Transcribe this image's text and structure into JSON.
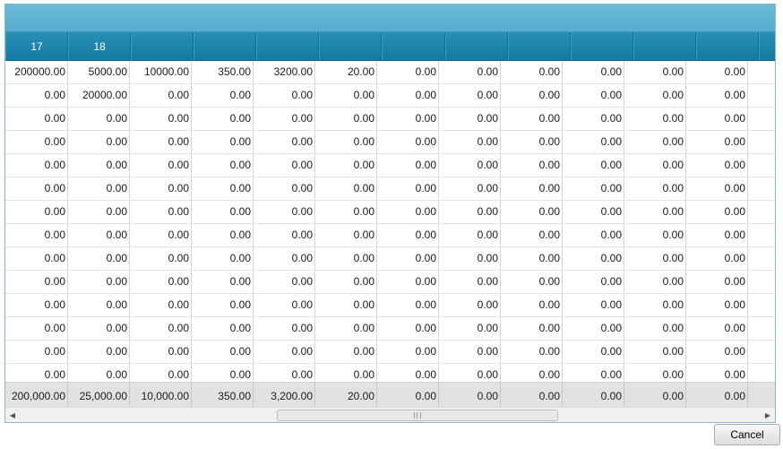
{
  "columns": [
    "17",
    "18",
    "",
    "",
    "",
    "",
    "",
    "",
    "",
    "",
    "",
    ""
  ],
  "rows": [
    [
      "200000.00",
      "5000.00",
      "10000.00",
      "350.00",
      "3200.00",
      "20.00",
      "0.00",
      "0.00",
      "0.00",
      "0.00",
      "0.00",
      "0.00"
    ],
    [
      "0.00",
      "20000.00",
      "0.00",
      "0.00",
      "0.00",
      "0.00",
      "0.00",
      "0.00",
      "0.00",
      "0.00",
      "0.00",
      "0.00"
    ],
    [
      "0.00",
      "0.00",
      "0.00",
      "0.00",
      "0.00",
      "0.00",
      "0.00",
      "0.00",
      "0.00",
      "0.00",
      "0.00",
      "0.00"
    ],
    [
      "0.00",
      "0.00",
      "0.00",
      "0.00",
      "0.00",
      "0.00",
      "0.00",
      "0.00",
      "0.00",
      "0.00",
      "0.00",
      "0.00"
    ],
    [
      "0.00",
      "0.00",
      "0.00",
      "0.00",
      "0.00",
      "0.00",
      "0.00",
      "0.00",
      "0.00",
      "0.00",
      "0.00",
      "0.00"
    ],
    [
      "0.00",
      "0.00",
      "0.00",
      "0.00",
      "0.00",
      "0.00",
      "0.00",
      "0.00",
      "0.00",
      "0.00",
      "0.00",
      "0.00"
    ],
    [
      "0.00",
      "0.00",
      "0.00",
      "0.00",
      "0.00",
      "0.00",
      "0.00",
      "0.00",
      "0.00",
      "0.00",
      "0.00",
      "0.00"
    ],
    [
      "0.00",
      "0.00",
      "0.00",
      "0.00",
      "0.00",
      "0.00",
      "0.00",
      "0.00",
      "0.00",
      "0.00",
      "0.00",
      "0.00"
    ],
    [
      "0.00",
      "0.00",
      "0.00",
      "0.00",
      "0.00",
      "0.00",
      "0.00",
      "0.00",
      "0.00",
      "0.00",
      "0.00",
      "0.00"
    ],
    [
      "0.00",
      "0.00",
      "0.00",
      "0.00",
      "0.00",
      "0.00",
      "0.00",
      "0.00",
      "0.00",
      "0.00",
      "0.00",
      "0.00"
    ],
    [
      "0.00",
      "0.00",
      "0.00",
      "0.00",
      "0.00",
      "0.00",
      "0.00",
      "0.00",
      "0.00",
      "0.00",
      "0.00",
      "0.00"
    ],
    [
      "0.00",
      "0.00",
      "0.00",
      "0.00",
      "0.00",
      "0.00",
      "0.00",
      "0.00",
      "0.00",
      "0.00",
      "0.00",
      "0.00"
    ],
    [
      "0.00",
      "0.00",
      "0.00",
      "0.00",
      "0.00",
      "0.00",
      "0.00",
      "0.00",
      "0.00",
      "0.00",
      "0.00",
      "0.00"
    ],
    [
      "0.00",
      "0.00",
      "0.00",
      "0.00",
      "0.00",
      "0.00",
      "0.00",
      "0.00",
      "0.00",
      "0.00",
      "0.00",
      "0.00"
    ]
  ],
  "totals": [
    "200,000.00",
    "25,000.00",
    "10,000.00",
    "350.00",
    "3,200.00",
    "20.00",
    "0.00",
    "0.00",
    "0.00",
    "0.00",
    "0.00",
    "0.00"
  ],
  "scroll": {
    "left_icon": "scroll-left-arrow-icon",
    "right_icon": "scroll-right-arrow-icon",
    "left_glyph": "◀",
    "right_glyph": "▶"
  },
  "cancel_label": "Cancel",
  "colors": {
    "header": "#137aa2",
    "title_bar": "#5fb4d3",
    "totals_bg": "#e2e2e2"
  }
}
